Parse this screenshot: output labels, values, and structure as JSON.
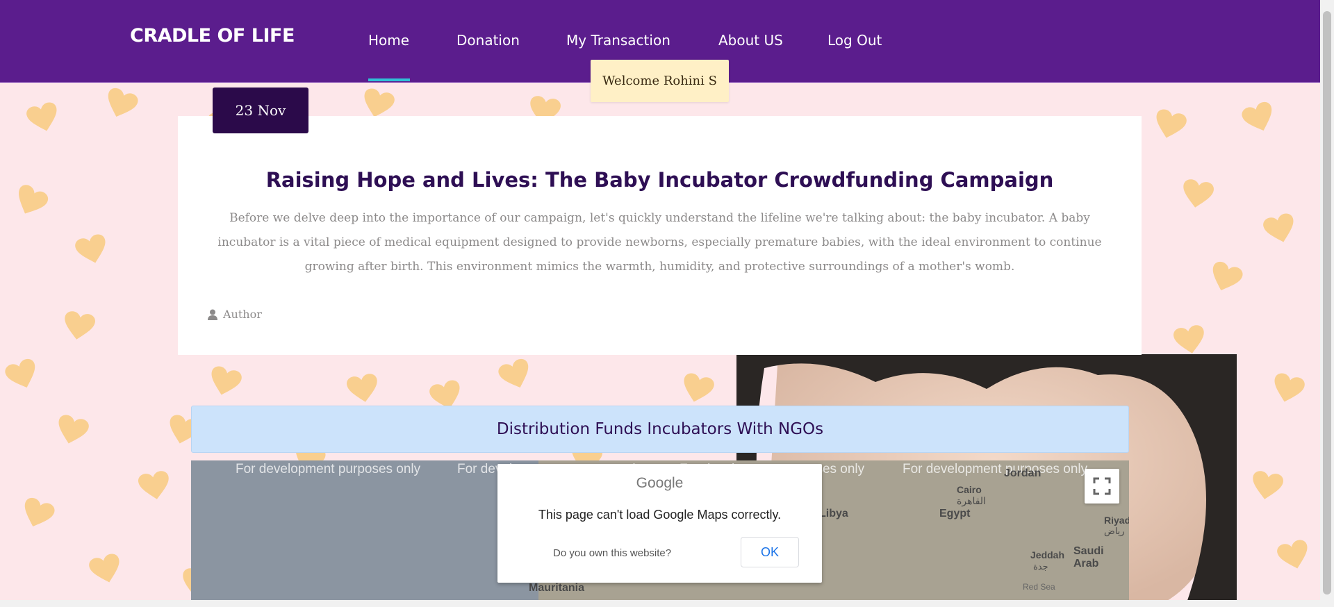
{
  "header": {
    "brand": "CRADLE OF LIFE",
    "nav": [
      "Home",
      "Donation",
      "My Transaction",
      "About US",
      "Log Out"
    ],
    "active_nav": "Home",
    "welcome": "Welcome Rohini S"
  },
  "post": {
    "date": "23 Nov",
    "title": "Raising Hope and Lives: The Baby Incubator Crowdfunding Campaign",
    "body": "Before we delve deep into the importance of our campaign, let's quickly understand the lifeline we're talking about: the baby incubator. A baby incubator is a vital piece of medical equipment designed to provide newborns, especially premature babies, with the ideal environment to continue growing after birth. This environment mimics the warmth, humidity, and protective surroundings of a mother's womb.",
    "author": "Author"
  },
  "distribution": {
    "heading": "Distribution Funds Incubators With NGOs"
  },
  "map": {
    "watermark": "For development purposes only",
    "labels": [
      "Jordan",
      "Cairo",
      "القاهرة",
      "Libya",
      "Egypt",
      "Riyad",
      "رياض",
      "Saudi Arab",
      "Jeddah",
      "جدة",
      "Red Sea",
      "Mauritania"
    ],
    "dialog": {
      "logo": "Google",
      "message": "This page can't load Google Maps correctly.",
      "question": "Do you own this website?",
      "ok": "OK"
    }
  },
  "colors": {
    "header_bg": "#5b1d8d",
    "nav_underline": "#2fc1d6",
    "welcome_bg": "#fff0c6",
    "badge_bg": "#2b0a4a",
    "title": "#2e0f54",
    "page_bg": "#fde7ea",
    "hearts": "#f9cf8f",
    "distribution_bg": "#cce3fb"
  }
}
